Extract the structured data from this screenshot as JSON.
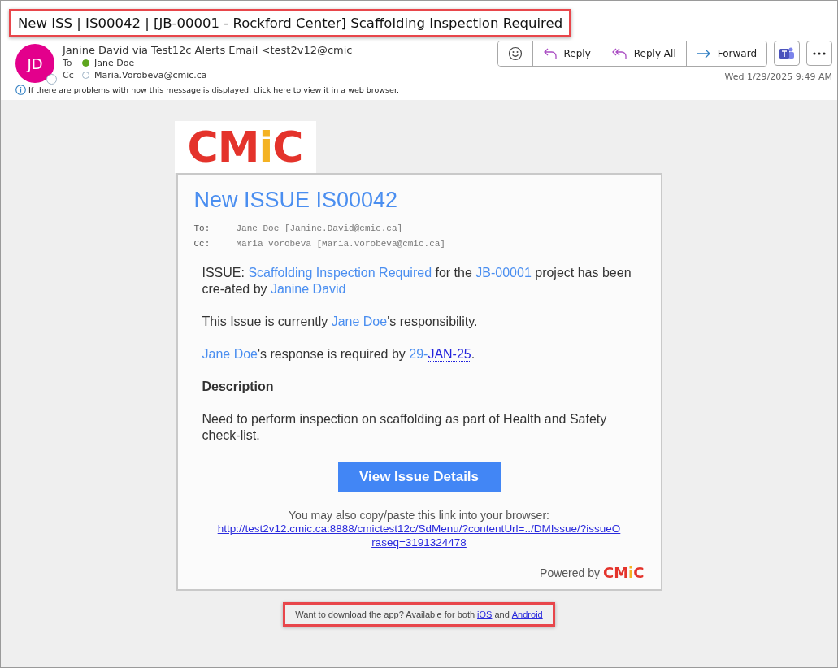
{
  "subject": {
    "text": "New ISS | IS00042 | [JB-00001 - Rockford Center] Scaffolding Inspection Required",
    "highlighted": true
  },
  "sender": {
    "initials": "JD",
    "name": "Janine David via Test12c Alerts Email <test2v12@cmic"
  },
  "recipients": [
    {
      "label": "To",
      "name": "Jane Doe",
      "accepted": true
    },
    {
      "label": "Cc",
      "name": "Maria.Vorobeva@cmic.ca",
      "accepted": false
    }
  ],
  "actions": [
    {
      "kind": "emoji"
    },
    {
      "kind": "reply",
      "label": "Reply"
    },
    {
      "kind": "reply_all",
      "label": "Reply All"
    },
    {
      "kind": "forward",
      "label": "Forward"
    }
  ],
  "extra_buttons": [
    {
      "kind": "teams"
    },
    {
      "kind": "more"
    }
  ],
  "date": "Wed 1/29/2025 9:49 AM",
  "info_bar": "If there are problems with how this message is displayed, click here to view it in a web browser.",
  "logo": [
    {
      "text": "CM",
      "color": "#e4332b"
    },
    {
      "text": "i",
      "color": "#f4b223"
    },
    {
      "text": "C",
      "color": "#e4332b"
    }
  ],
  "card": {
    "title": "New ISSUE IS00042",
    "headers": [
      {
        "label": "To:",
        "value": "Jane Doe [Janine.David@cmic.ca]"
      },
      {
        "label": "Cc:",
        "value": "Maria Vorobeva [Maria.Vorobeva@cmic.ca]"
      }
    ],
    "paragraphs": [
      {
        "kind": "text",
        "segments": [
          {
            "text": "ISSUE: ",
            "kind": "plain"
          },
          {
            "text": "Scaffolding Inspection Required",
            "kind": "link"
          },
          {
            "text": " for the ",
            "kind": "plain"
          },
          {
            "text": "JB-00001",
            "kind": "link"
          },
          {
            "text": " project has been cre-ated by ",
            "kind": "plain"
          },
          {
            "text": "Janine David",
            "kind": "link"
          }
        ]
      },
      {
        "kind": "text",
        "segments": [
          {
            "text": "This Issue is currently ",
            "kind": "plain"
          },
          {
            "text": "Jane Doe",
            "kind": "link"
          },
          {
            "text": "'s responsibility.",
            "kind": "plain"
          }
        ]
      },
      {
        "kind": "text",
        "segments": [
          {
            "text": "Jane Doe",
            "kind": "link"
          },
          {
            "text": "'s response is required by ",
            "kind": "plain"
          },
          {
            "text": "29-",
            "kind": "link"
          },
          {
            "text": "JAN-25",
            "kind": "date"
          },
          {
            "text": ".",
            "kind": "plain"
          }
        ]
      },
      {
        "kind": "heading",
        "segments": [
          {
            "text": "Description",
            "kind": "plain"
          }
        ]
      },
      {
        "kind": "text",
        "segments": [
          {
            "text": "Need to perform inspection on scaffolding as part of Health and Safety check-list.",
            "kind": "plain"
          }
        ]
      }
    ],
    "button": "View Issue Details",
    "copy_hint": "You may also copy/paste this link into your browser:",
    "url": "http://test2v12.cmic.ca:8888/cmictest12c/SdMenu/?contentUrl=../DMIssue/?issueOraseq=3191324478",
    "powered_by": "Powered by",
    "powered_logo": [
      {
        "text": "CM",
        "color": "#e4332b"
      },
      {
        "text": "i",
        "color": "#f4b223"
      },
      {
        "text": "C",
        "color": "#e4332b"
      }
    ]
  },
  "footer": {
    "highlighted": true,
    "text": "Want to download the app? Available for both",
    "link1": "iOS",
    "joiner": "and",
    "link2": "Android"
  }
}
